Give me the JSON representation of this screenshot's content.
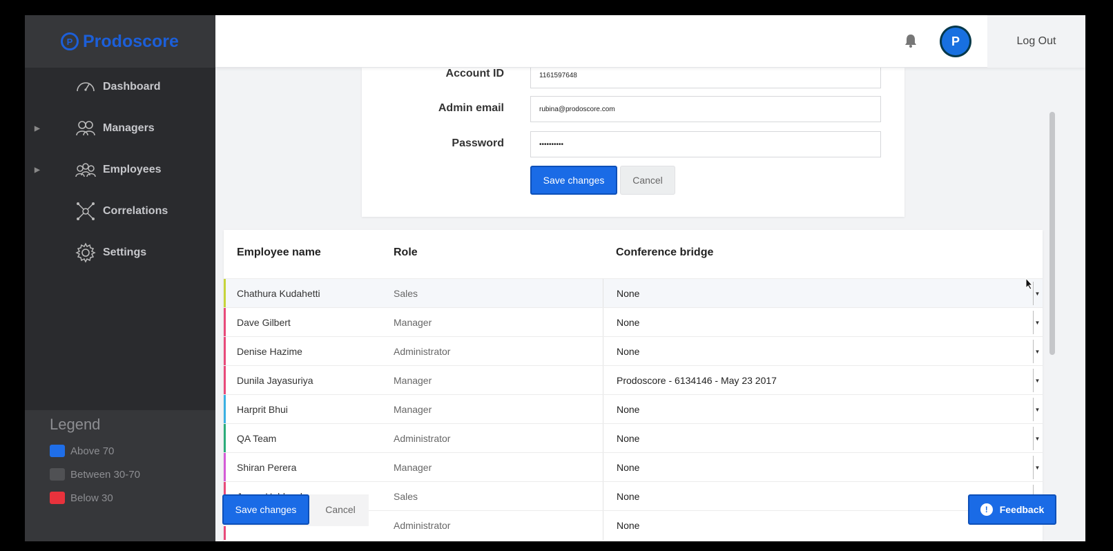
{
  "app": {
    "brand": "Prodoscore",
    "logo_glyph": "P"
  },
  "sidebar": {
    "items": [
      {
        "label": "Dashboard",
        "icon": "gauge-icon",
        "expandable": false
      },
      {
        "label": "Managers",
        "icon": "managers-icon",
        "expandable": true
      },
      {
        "label": "Employees",
        "icon": "employees-icon",
        "expandable": true
      },
      {
        "label": "Correlations",
        "icon": "correlations-icon",
        "expandable": false
      },
      {
        "label": "Settings",
        "icon": "gear-icon",
        "expandable": false
      }
    ]
  },
  "legend": {
    "title": "Legend",
    "items": [
      {
        "label": "Above 70",
        "color": "#1f6ee8"
      },
      {
        "label": "Between 30-70",
        "color": "#505154"
      },
      {
        "label": "Below 30",
        "color": "#e8323c"
      }
    ]
  },
  "topbar": {
    "avatar_glyph": "P",
    "logout_label": "Log Out"
  },
  "form": {
    "account_id_label": "Account ID",
    "account_id_value": "1161597648",
    "admin_email_label": "Admin email",
    "admin_email_value": "rubina@prodoscore.com",
    "password_label": "Password",
    "password_value": "••••••••••",
    "save_label": "Save changes",
    "cancel_label": "Cancel"
  },
  "table": {
    "headers": {
      "name": "Employee name",
      "role": "Role",
      "bridge": "Conference bridge"
    },
    "rows": [
      {
        "name": "Chathura Kudahetti",
        "role": "Sales",
        "bridge": "None",
        "accent": "#c6d43a"
      },
      {
        "name": "Dave Gilbert",
        "role": "Manager",
        "bridge": "None",
        "accent": "#e84a7a"
      },
      {
        "name": "Denise Hazime",
        "role": "Administrator",
        "bridge": "None",
        "accent": "#e84a7a"
      },
      {
        "name": "Dunila Jayasuriya",
        "role": "Manager",
        "bridge": "Prodoscore - 6134146 - May 23 2017",
        "accent": "#e84a7a"
      },
      {
        "name": "Harprit Bhui",
        "role": "Manager",
        "bridge": "None",
        "accent": "#3ab0e2"
      },
      {
        "name": "QA Team",
        "role": "Administrator",
        "bridge": "None",
        "accent": "#2bab7a"
      },
      {
        "name": "Shiran Perera",
        "role": "Manager",
        "bridge": "None",
        "accent": "#d45bd6"
      },
      {
        "name": "Jason Hubbard",
        "role": "Sales",
        "bridge": "None",
        "accent": "#e84a7a"
      },
      {
        "name": "",
        "role": "Administrator",
        "bridge": "None",
        "accent": "#e84a7a"
      }
    ]
  },
  "bottom": {
    "save_label": "Save changes",
    "cancel_label": "Cancel"
  },
  "feedback": {
    "label": "Feedback",
    "glyph": "!"
  }
}
